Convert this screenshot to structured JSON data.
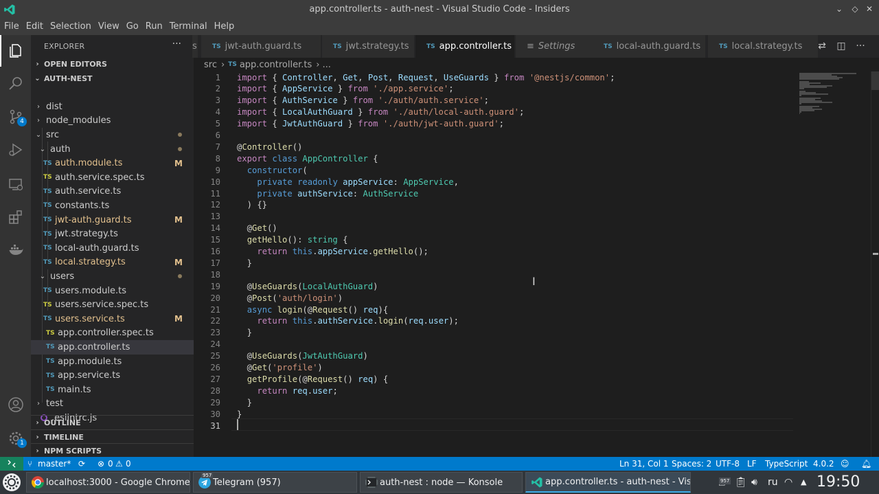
{
  "window": {
    "title": "app.controller.ts - auth-nest - Visual Studio Code - Insiders"
  },
  "menu": [
    "File",
    "Edit",
    "Selection",
    "View",
    "Go",
    "Run",
    "Terminal",
    "Help"
  ],
  "activity": {
    "scm_badge": "4",
    "settings_badge": "1"
  },
  "sidebar": {
    "title": "EXPLORER",
    "more": "···",
    "open_editors": "OPEN EDITORS",
    "project": "AUTH-NEST",
    "outline": "OUTLINE",
    "timeline": "TIMELINE",
    "npm_scripts": "NPM SCRIPTS",
    "tree": [
      {
        "label": "dist",
        "kind": "folder",
        "expanded": false
      },
      {
        "label": "node_modules",
        "kind": "folder",
        "expanded": false
      },
      {
        "label": "src",
        "kind": "folder",
        "expanded": true
      },
      {
        "label": "auth",
        "kind": "folder",
        "expanded": true
      },
      {
        "label": "auth.module.ts",
        "kind": "ts",
        "status": "M"
      },
      {
        "label": "auth.service.spec.ts",
        "kind": "spec"
      },
      {
        "label": "auth.service.ts",
        "kind": "ts"
      },
      {
        "label": "constants.ts",
        "kind": "ts"
      },
      {
        "label": "jwt-auth.guard.ts",
        "kind": "ts",
        "status": "M"
      },
      {
        "label": "jwt.strategy.ts",
        "kind": "ts"
      },
      {
        "label": "local-auth.guard.ts",
        "kind": "ts"
      },
      {
        "label": "local.strategy.ts",
        "kind": "ts",
        "status": "M"
      },
      {
        "label": "users",
        "kind": "folder",
        "expanded": true
      },
      {
        "label": "users.module.ts",
        "kind": "ts"
      },
      {
        "label": "users.service.spec.ts",
        "kind": "spec"
      },
      {
        "label": "users.service.ts",
        "kind": "ts",
        "status": "M"
      },
      {
        "label": "app.controller.spec.ts",
        "kind": "spec"
      },
      {
        "label": "app.controller.ts",
        "kind": "ts",
        "selected": true
      },
      {
        "label": "app.module.ts",
        "kind": "ts"
      },
      {
        "label": "app.service.ts",
        "kind": "ts"
      },
      {
        "label": "main.ts",
        "kind": "ts"
      },
      {
        "label": "test",
        "kind": "folder",
        "expanded": false
      },
      {
        "label": ".eslintrc.js",
        "kind": "eslint"
      }
    ]
  },
  "tabs": [
    {
      "label": "s",
      "kind": "partial"
    },
    {
      "label": "jwt-auth.guard.ts",
      "kind": "ts"
    },
    {
      "label": "jwt.strategy.ts",
      "kind": "ts"
    },
    {
      "label": "app.controller.ts",
      "kind": "ts",
      "active": true
    },
    {
      "label": "Settings",
      "kind": "settings"
    },
    {
      "label": "local-auth.guard.ts",
      "kind": "ts"
    },
    {
      "label": "local.strategy.ts",
      "kind": "ts"
    }
  ],
  "breadcrumb": {
    "folder": "src",
    "file": "app.controller.ts",
    "more": "..."
  },
  "status": {
    "branch": "master*",
    "problems": "0",
    "warnings": "0",
    "position": "Ln 31, Col 1",
    "spaces": "Spaces: 2",
    "encoding": "UTF-8",
    "eol": "LF",
    "language": "TypeScript",
    "version": "4.0.2"
  },
  "taskbar": {
    "tasks": [
      "localhost:3000 - Google Chrome",
      "Telegram (957)",
      "auth-nest : node — Konsole",
      "app.controller.ts - auth-nest - Visu..."
    ],
    "telegram_badge": "957",
    "tray_badge": "957",
    "lang": "ru",
    "clock": "19:50"
  },
  "colors": {
    "accent": "#007acc",
    "editor_bg": "#1e1e1e",
    "sidebar_bg": "#252526",
    "activity_bg": "#333333",
    "modified": "#e2c08d",
    "ts_icon": "#519aba"
  }
}
